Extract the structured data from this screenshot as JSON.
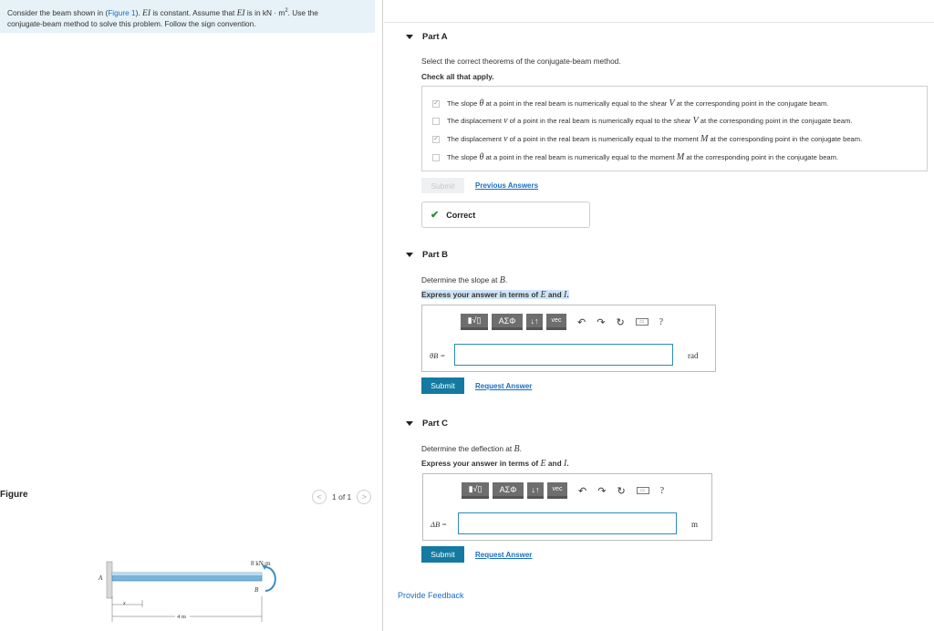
{
  "problem": {
    "text_before_link": "Consider the beam shown in (",
    "link": "Figure 1",
    "text_after_link": "). ",
    "ei_symbol": "EI",
    "text_mid": " is constant. Assume that ",
    "ei_symbol2": "EI",
    "text_units": " is in kN · m",
    "units_exp": "2",
    "text_end": ". Use the",
    "line2": "conjugate-beam method to solve this problem. Follow the sign convention."
  },
  "figure": {
    "label": "Figure",
    "pager_text": "1 of 1",
    "prev_glyph": "<",
    "next_glyph": ">",
    "moment_label": "8 kN·m",
    "point_a": "A",
    "point_b": "B",
    "x_label": "x",
    "length_label": "4 m"
  },
  "partA": {
    "title": "Part A",
    "prompt": "Select the correct theorems of the conjugate-beam method.",
    "instruction": "Check all that apply.",
    "options": [
      {
        "checked": "✓",
        "a": "The slope ",
        "sym1": "θ",
        "b": " at a point in the real beam is numerically equal to the shear ",
        "sym2": "V",
        "c": " at the corresponding point in the conjugate beam."
      },
      {
        "checked": "",
        "a": "The displacement ",
        "sym1": "v",
        "b": " of a point in the real beam is numerically equal to the shear ",
        "sym2": "V",
        "c": " at the corresponding point in the conjugate beam."
      },
      {
        "checked": "✓",
        "a": "The displacement ",
        "sym1": "v",
        "b": " of a point in the real beam is numerically equal to the moment ",
        "sym2": "M",
        "c": " at the corresponding point in the conjugate beam."
      },
      {
        "checked": "",
        "a": "The slope ",
        "sym1": "θ",
        "b": " at a point in the real beam is numerically equal to the moment ",
        "sym2": "M",
        "c": " at the corresponding point in the conjugate beam."
      }
    ],
    "submit_label": "Submit",
    "previous_answers": "Previous Answers",
    "feedback": "Correct"
  },
  "partB": {
    "title": "Part B",
    "prompt_a": "Determine the slope at ",
    "prompt_sym": "B",
    "prompt_b": ".",
    "instruction_a": "Express your answer in terms of ",
    "instruction_e": "E",
    "instruction_and": " and ",
    "instruction_i": "I",
    "instruction_end": ".",
    "variable": "θB =",
    "unit": "rad",
    "submit_label": "Submit",
    "request_answer": "Request Answer"
  },
  "partC": {
    "title": "Part C",
    "prompt_a": "Determine the deflection at ",
    "prompt_sym": "B",
    "prompt_b": ".",
    "instruction_a": "Express your answer in terms of ",
    "instruction_e": "E",
    "instruction_and": " and ",
    "instruction_i": "I",
    "instruction_end": ".",
    "variable": "ΔB =",
    "unit": "m",
    "submit_label": "Submit",
    "request_answer": "Request Answer"
  },
  "toolbar": {
    "templates": "▮√▯",
    "greek": "ΑΣΦ",
    "arrows": "↓↑",
    "vec": "vec",
    "undo": "↶",
    "redo": "↷",
    "reset": "↻",
    "keyboard": "▭",
    "help": "?"
  },
  "footer": {
    "provide_feedback": "Provide Feedback"
  }
}
